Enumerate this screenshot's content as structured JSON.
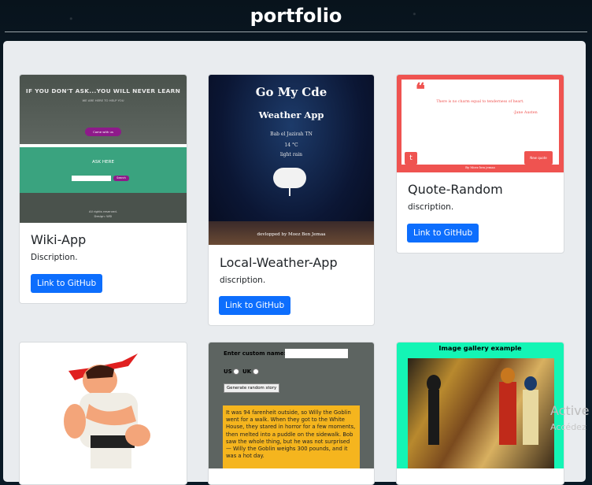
{
  "header": {
    "title": "portfolio"
  },
  "cards": [
    {
      "title": "Wiki-App",
      "text": "Discription.",
      "button": "Link to GitHub",
      "thumb": {
        "line1": "IF YOU DON'T ASK...YOU WILL NEVER LEARN",
        "line2": "WE ARE HERE TO HELP YOU",
        "btn1": "Come with us",
        "heading": "ASK HERE",
        "btn2": "Search",
        "footer1": "All rights reserved.",
        "footer2": "Design: WSI"
      }
    },
    {
      "title": "Local-Weather-App",
      "text": "discription.",
      "button": "Link to GitHub",
      "thumb": {
        "t1": "Go My Cde",
        "t2": "Weather App",
        "place": "Bab el Jazirah TN",
        "temp": "14 °C",
        "cond": "light rain",
        "credit": "devlopped by Moez Ben Jemaa"
      }
    },
    {
      "title": "Quote-Random",
      "text": "discription.",
      "button": "Link to GitHub",
      "thumb": {
        "quote": "There is no charm equal to tenderness of heart.",
        "author": "-Jane Austen",
        "newq": "New quote",
        "credit": "By Moez ben jemaa"
      }
    },
    {
      "thumb": {
        "image": "Ryu fighter sprite"
      }
    },
    {
      "thumb": {
        "label": "Enter custom name:",
        "us": "US",
        "uk": "UK",
        "gen": "Generate random story",
        "story": "It was 94 farenheit outside, so Willy the Goblin went for a walk. When they got to the White House, they stared in horror for a few moments, then melted into a puddle on the sidewalk. Bob saw the whole thing, but he was not surprised — Willy the Goblin weighs 300 pounds, and it was a hot day."
      }
    },
    {
      "thumb": {
        "title": "Image gallery example"
      }
    }
  ],
  "watermark": {
    "line1": "Active",
    "line2": "Accédez"
  },
  "colors": {
    "primary": "#0d6efd",
    "panel": "#e9ecef",
    "quote_red": "#ef5350",
    "gallery_bg": "#14f5b5"
  }
}
